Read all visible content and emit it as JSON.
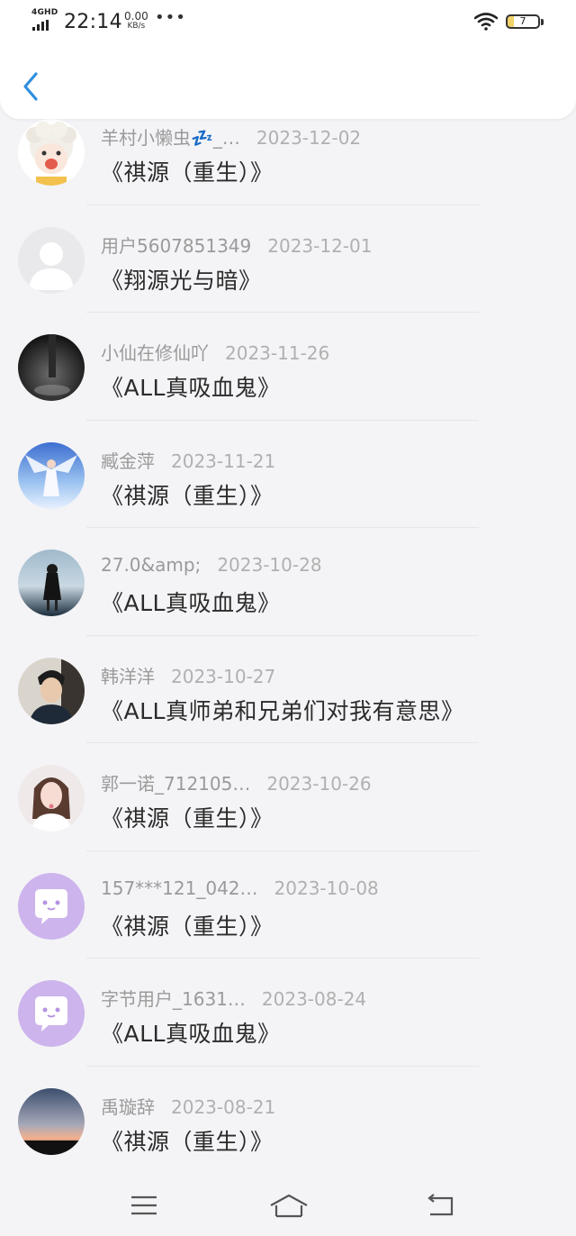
{
  "status_bar": {
    "network": "4GHD",
    "time": "22:14",
    "speed_value": "0.00",
    "speed_unit": "KB/s",
    "more": "•••",
    "battery": "7"
  },
  "header": {
    "back_icon": "chevron-left-icon",
    "accent_color": "#2f8fe0"
  },
  "items": [
    {
      "username": "羊村小懒虫💤_…",
      "date": "2023-12-02",
      "title": "《祺源（重生）》",
      "avatar": "cartoon-sheep"
    },
    {
      "username": "用户5607851349",
      "date": "2023-12-01",
      "title": "《翔源光与暗》",
      "avatar": "default-gray"
    },
    {
      "username": "小仙在修仙吖",
      "date": "2023-11-26",
      "title": "《ALL真吸血鬼》",
      "avatar": "dark-photo"
    },
    {
      "username": "臧金萍",
      "date": "2023-11-21",
      "title": "《祺源（重生）》",
      "avatar": "angel-photo"
    },
    {
      "username": "27.0&amp;",
      "date": "2023-10-28",
      "title": "《ALL真吸血鬼》",
      "avatar": "girl-water-photo"
    },
    {
      "username": "韩洋洋",
      "date": "2023-10-27",
      "title": "《ALL真师弟和兄弟们对我有意思》",
      "avatar": "boy-photo"
    },
    {
      "username": "郭一诺_712105…",
      "date": "2023-10-26",
      "title": "《祺源（重生）》",
      "avatar": "girl-portrait-photo"
    },
    {
      "username": "157***121_042…",
      "date": "2023-10-08",
      "title": "《祺源（重生）》",
      "avatar": "purple-chat-default"
    },
    {
      "username": "字节用户_1631…",
      "date": "2023-08-24",
      "title": "《ALL真吸血鬼》",
      "avatar": "purple-chat-default"
    },
    {
      "username": "禹璇辞",
      "date": "2023-08-21",
      "title": "《祺源（重生）》",
      "avatar": "sunset-photo"
    }
  ],
  "bottom_nav": {
    "menu_icon": "menu-icon",
    "home_icon": "home-icon",
    "back_icon": "return-icon"
  }
}
